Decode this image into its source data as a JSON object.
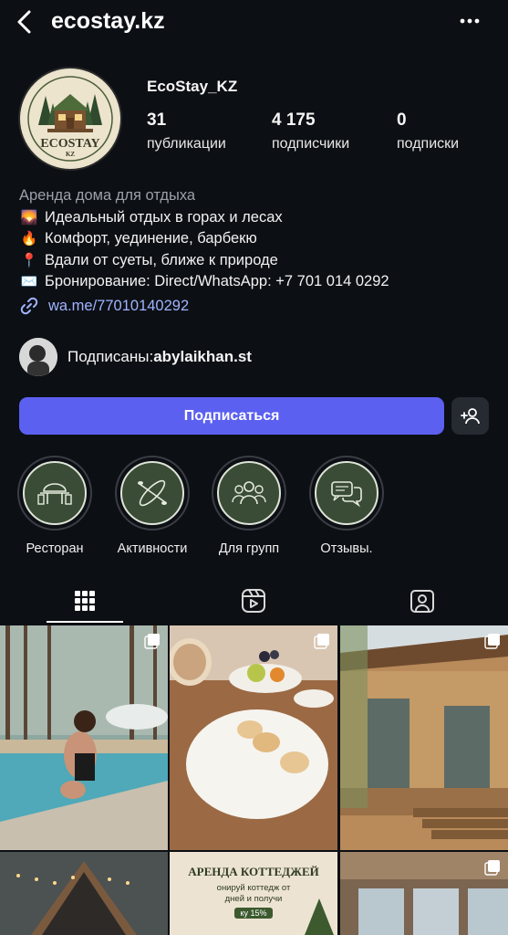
{
  "header": {
    "handle": "ecostay.kz",
    "back_icon": "chevron-left-icon",
    "more_icon": "more-horizontal-icon"
  },
  "profile": {
    "display_name": "EcoStay_KZ",
    "logo_text": "ECOSTAY",
    "logo_sub": "KZ",
    "stats": [
      {
        "value": "31",
        "label": "публикации"
      },
      {
        "value": "4 175",
        "label": "подписчики"
      },
      {
        "value": "0",
        "label": "подписки"
      }
    ]
  },
  "bio": {
    "category": "Аренда дома для отдыха",
    "lines": [
      {
        "emoji": "🌄",
        "text": "Идеальный отдых в горах и лесах"
      },
      {
        "emoji": "🔥",
        "text": "Комфорт, уединение, барбекю"
      },
      {
        "emoji": "📍",
        "text": "Вдали от суеты, ближе к природе"
      },
      {
        "emoji": "✉️",
        "text": "Бронирование: Direct/WhatsApp: +7 701 014 0292"
      }
    ],
    "link": "wa.me/77010140292"
  },
  "followed_by": {
    "prefix": "Подписаны: ",
    "user": "abylaikhan.st"
  },
  "actions": {
    "follow_label": "Подписаться",
    "suggest_icon": "add-person-icon"
  },
  "highlights": [
    {
      "label": "Ресторан",
      "icon": "restaurant-table-icon"
    },
    {
      "label": "Активности",
      "icon": "kayak-icon"
    },
    {
      "label": "Для групп",
      "icon": "group-icon"
    },
    {
      "label": "Отзывы.",
      "icon": "chat-bubbles-icon"
    }
  ],
  "tabs": [
    {
      "name": "grid",
      "icon": "grid-icon",
      "active": true
    },
    {
      "name": "reels",
      "icon": "reels-icon",
      "active": false
    },
    {
      "name": "tagged",
      "icon": "tagged-person-icon",
      "active": false
    }
  ],
  "posts": [
    {
      "subject": "woman in pool near forest",
      "multi": true
    },
    {
      "subject": "breakfast plate with syrniki",
      "multi": true
    },
    {
      "subject": "wooden cabin terrace",
      "multi": true
    },
    {
      "subject": "a-frame cabin with lights",
      "multi": false
    },
    {
      "subject": "cottage rental promo",
      "promo_title": "АРЕНДА КОТТЕДЖЕЙ",
      "promo_sub_1": "онируй коттедж от",
      "promo_sub_2": "дней и получи",
      "promo_discount": "ку 15%",
      "multi": false
    },
    {
      "subject": "cabin interior windows",
      "multi": true
    }
  ],
  "colors": {
    "accent": "#5b60f0",
    "link": "#9fb4ff",
    "background": "#0c0f14",
    "muted": "#9ba1a8"
  }
}
